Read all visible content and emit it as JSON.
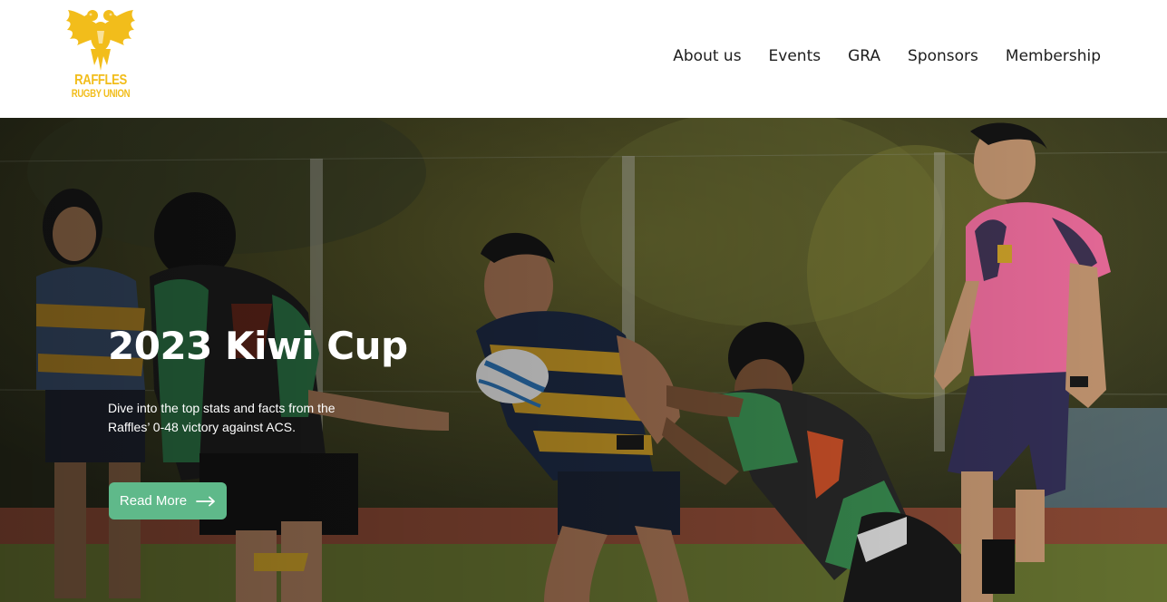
{
  "brand": {
    "logo_line1": "RAFFLES",
    "logo_line2": "RUGBY UNION",
    "logo_icon": "phoenix-icon",
    "color": "#f2bd1b"
  },
  "nav": {
    "items": [
      {
        "label": "About us"
      },
      {
        "label": "Events"
      },
      {
        "label": "GRA"
      },
      {
        "label": "Sponsors"
      },
      {
        "label": "Membership"
      }
    ]
  },
  "hero": {
    "title": "2023 Kiwi Cup",
    "description": "Dive into the top stats and facts from the Raffles’ 0-48 victory against ACS.",
    "button_label": "Read More",
    "button_icon": "arrow-right-icon",
    "button_color": "#5fb98a"
  }
}
